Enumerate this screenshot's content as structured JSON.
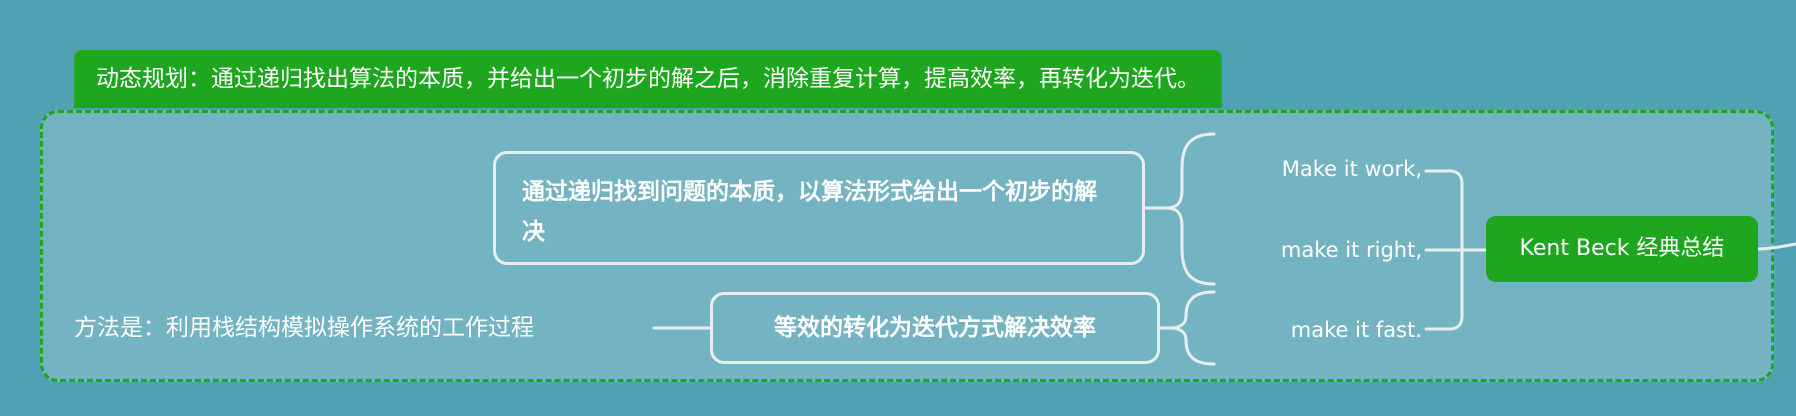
{
  "summary": {
    "text": "动态规划：通过递归找出算法的本质，并给出一个初步的解之后，消除重复计算，提高效率，再转化为迭代。"
  },
  "topics": {
    "recursion_essence": "通过递归找到问题的本质，以算法形式给出一个初步的解决",
    "iteration_efficiency": "等效的转化为迭代方式解决效率"
  },
  "method": {
    "text": "方法是：利用栈结构模拟操作系统的工作过程"
  },
  "kent_beck": {
    "label": "Kent Beck 经典总结",
    "lines": [
      "Make it work,",
      "make it right,",
      "make it fast."
    ]
  },
  "colors": {
    "background": "#4fa2b4",
    "boundary_fill": "#74b4c2",
    "accent_green": "#1ea61e",
    "line": "#e8eef0",
    "text": "#ffffff"
  }
}
